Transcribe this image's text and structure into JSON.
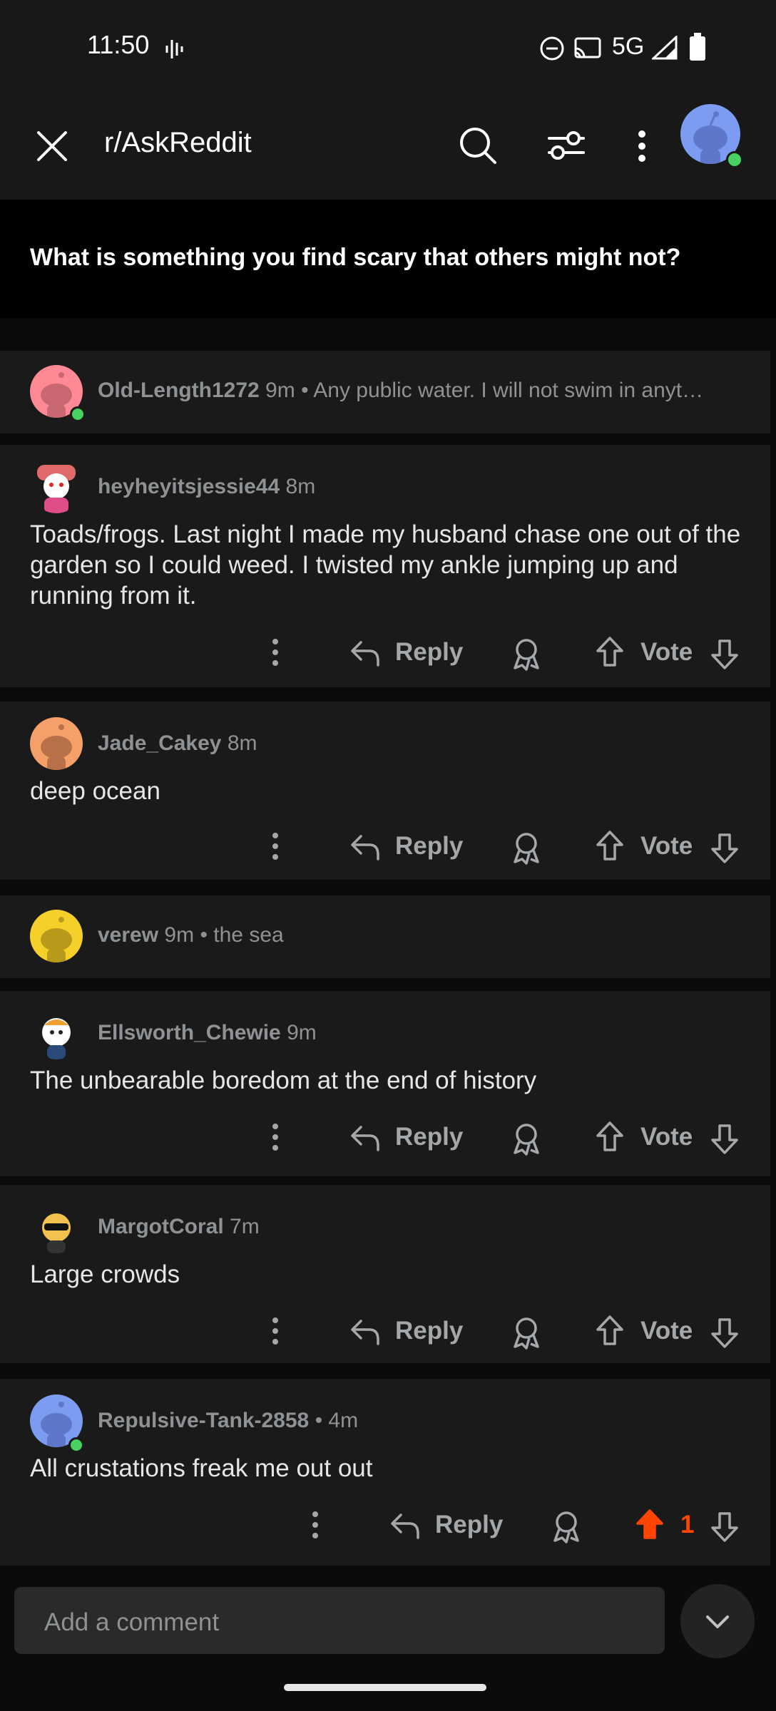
{
  "status": {
    "time": "11:50",
    "network": "5G"
  },
  "header": {
    "subreddit": "r/AskReddit"
  },
  "post": {
    "title": "What is something you find scary that others might not?"
  },
  "comments": [
    {
      "user": "Old-Length1272",
      "time": "9m",
      "collapsed": true,
      "text": "• Any public water. I will not swim in anyt…",
      "avatar_color": "#ff8a95"
    },
    {
      "user": "heyheyitsjessie44",
      "time": "8m",
      "collapsed": false,
      "text": "Toads/frogs.  Last night I made my husband chase one out of the garden so I could weed.  I twisted my ankle jumping up and running from it.",
      "avatar_color": "#f2d4d7"
    },
    {
      "user": "Jade_Cakey",
      "time": "8m",
      "collapsed": false,
      "text": "deep ocean",
      "avatar_color": "#f4a068"
    },
    {
      "user": "verew",
      "time": "9m",
      "collapsed": true,
      "text": "• the sea",
      "avatar_color": "#f5cf2a"
    },
    {
      "user": "Ellsworth_Chewie",
      "time": "9m",
      "collapsed": false,
      "text": "The unbearable boredom at the end of history",
      "avatar_color": "#1a1a1b"
    },
    {
      "user": "MargotCoral",
      "time": "7m",
      "collapsed": false,
      "text": "Large crowds",
      "avatar_color": "#1a1a1b"
    },
    {
      "user": "Repulsive-Tank-2858",
      "time": "• 4m",
      "collapsed": false,
      "text": "All crustations freak me out out",
      "avatar_color": "#7b9cf0",
      "score": "1"
    }
  ],
  "actions": {
    "reply": "Reply",
    "vote": "Vote"
  },
  "composer": {
    "placeholder": "Add a comment"
  },
  "colors": {
    "upvote": "#ff4500",
    "online": "#46d160"
  }
}
